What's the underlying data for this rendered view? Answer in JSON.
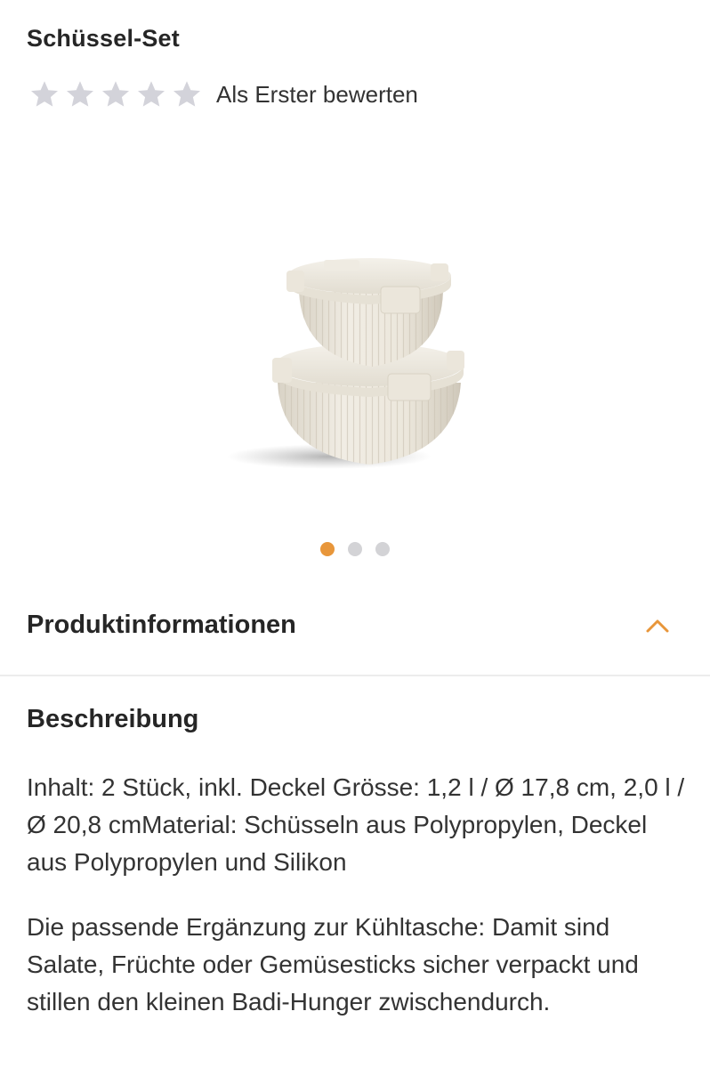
{
  "product": {
    "title": "Schüssel-Set",
    "rating": {
      "stars_filled": 0,
      "stars_total": 5,
      "text": "Als Erster bewerten"
    },
    "image": {
      "alt_icon": "bowl-set-image",
      "carousel_count": 3,
      "carousel_active": 1
    }
  },
  "section": {
    "title": "Produktinformationen",
    "state": "expanded",
    "subheading": "Beschreibung",
    "paragraphs": [
      "Inhalt: 2 Stück, inkl. Deckel Grösse: 1,2 l / Ø 17,8 cm, 2,0 l / Ø 20,8 cmMaterial: Schüsseln aus Polypropylen, Deckel aus Polypropylen und Silikon",
      "Die passende Ergänzung zur Kühltasche: Damit sind Salate, Früchte oder Gemüsesticks sicher verpackt und stillen den kleinen Badi-Hunger zwischendurch."
    ]
  },
  "colors": {
    "accent": "#e8963a",
    "star_empty": "#d3d3da",
    "text": "#2b2b2b"
  }
}
